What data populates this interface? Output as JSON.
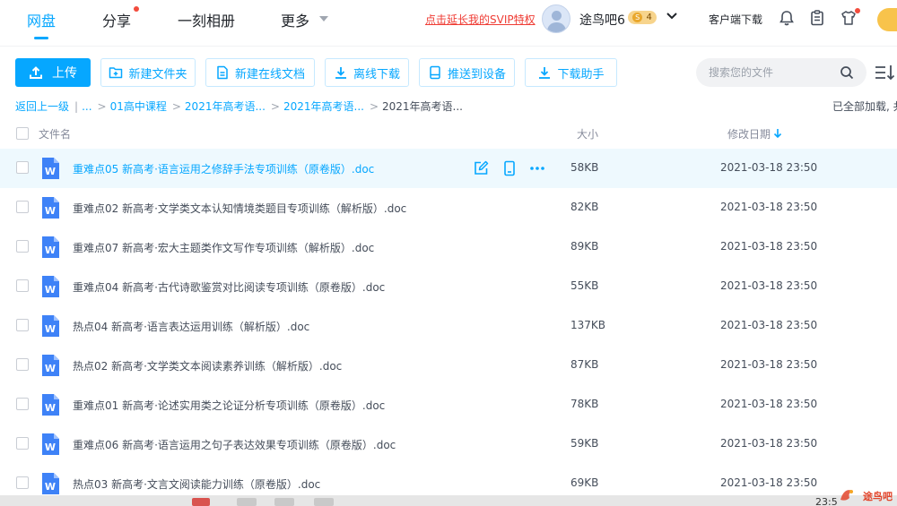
{
  "nav": {
    "tabs": [
      "网盘",
      "分享",
      "一刻相册",
      "更多"
    ],
    "svip_link": "点击延长我的SVIP特权",
    "username": "途鸟吧6",
    "badge_level": "4",
    "badge_coin": "S",
    "client_download": "客户端下载"
  },
  "toolbar": {
    "upload": "上传",
    "new_folder": "新建文件夹",
    "new_online_doc": "新建在线文档",
    "offline_download": "离线下载",
    "push_to_device": "推送到设备",
    "download_helper": "下载助手",
    "search_placeholder": "搜索您的文件"
  },
  "breadcrumb": {
    "back": "返回上一级",
    "ellipsis": "...",
    "items": [
      "01高中课程",
      "2021年高考语...",
      "2021年高考语..."
    ],
    "current": "2021年高考语...",
    "loaded_status": "已全部加载, 共"
  },
  "table": {
    "headers": {
      "name": "文件名",
      "size": "大小",
      "date": "修改日期"
    },
    "rows": [
      {
        "name": "重难点05 新高考·语言运用之修辞手法专项训练（原卷版）.doc",
        "size": "58KB",
        "date": "2021-03-18 23:50"
      },
      {
        "name": "重难点02 新高考·文学类文本认知情境类题目专项训练（解析版）.doc",
        "size": "82KB",
        "date": "2021-03-18 23:50"
      },
      {
        "name": "重难点07 新高考·宏大主题类作文写作专项训练（解析版）.doc",
        "size": "89KB",
        "date": "2021-03-18 23:50"
      },
      {
        "name": "重难点04 新高考·古代诗歌鉴赏对比阅读专项训练（原卷版）.doc",
        "size": "55KB",
        "date": "2021-03-18 23:50"
      },
      {
        "name": "热点04 新高考·语言表达运用训练（解析版）.doc",
        "size": "137KB",
        "date": "2021-03-18 23:50"
      },
      {
        "name": "热点02 新高考·文学类文本阅读素养训练（解析版）.doc",
        "size": "87KB",
        "date": "2021-03-18 23:50"
      },
      {
        "name": "重难点01 新高考·论述实用类之论证分析专项训练（原卷版）.doc",
        "size": "78KB",
        "date": "2021-03-18 23:50"
      },
      {
        "name": "重难点06 新高考·语言运用之句子表达效果专项训练（原卷版）.doc",
        "size": "59KB",
        "date": "2021-03-18 23:50"
      },
      {
        "name": "热点03 新高考·文言文阅读能力训练（原卷版）.doc",
        "size": "69KB",
        "date": "2021-03-18 23:50"
      }
    ]
  },
  "taskbar": {
    "clock": "23:5"
  },
  "watermark": {
    "text": "途鸟吧"
  },
  "colors": {
    "accent": "#06a7ff",
    "red": "#ef3c34",
    "hover_row": "#eef9fe",
    "word_blue": "#3e82f7"
  }
}
